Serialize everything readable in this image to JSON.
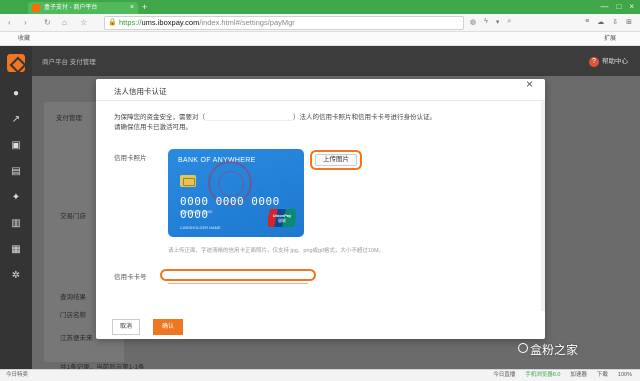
{
  "browser": {
    "tab_title": "盒子支付 - 商户平台",
    "url_scheme": "https://",
    "url_host": "ums.iboxpay.com",
    "url_path": "/index.html#/settings/payMgr",
    "bookmark_label": "收藏",
    "extension_label": "扩展"
  },
  "app": {
    "breadcrumb": "商户平台    支付管理",
    "help_label": "帮助中心",
    "page_section": "支付管理",
    "store_label": "交易门店",
    "result_label": "查询结果",
    "store_name_col": "门店名称",
    "row_text": "江苏便未来",
    "pager": "共1条记录，当前显示第1-1条"
  },
  "modal": {
    "title": "法人信用卡认证",
    "notice_part1": "为保障您的资金安全，需要对（",
    "notice_part2": "）法人的信用卡照片和信用卡卡号进行身份认证。",
    "notice_line2": "请确保信用卡已激活可用。",
    "photo_label": "信用卡照片",
    "upload_button": "上传图片",
    "hint": "请上传正面、字迹清晰的信用卡正面照片，仅支持 jpg、png或gif格式，大小不超过10M。",
    "card_number_label": "信用卡卡号",
    "cancel_button": "取消",
    "confirm_button": "确认"
  },
  "card": {
    "bank_name": "BANK OF ANYWHERE",
    "number": "0000 0000 0000 0000",
    "sub": "0000    VALID 00/00",
    "holder": "CARDHOLDER NAME",
    "unionpay_en": "UnionPay",
    "unionpay_cn": "银联"
  },
  "status": {
    "left": "今日特卖",
    "live": "今日直播",
    "browser_ver": "手机浏览器8.0",
    "accel": "加速器",
    "download": "下载",
    "zoom": "100%"
  },
  "watermark": "盒粉之家"
}
